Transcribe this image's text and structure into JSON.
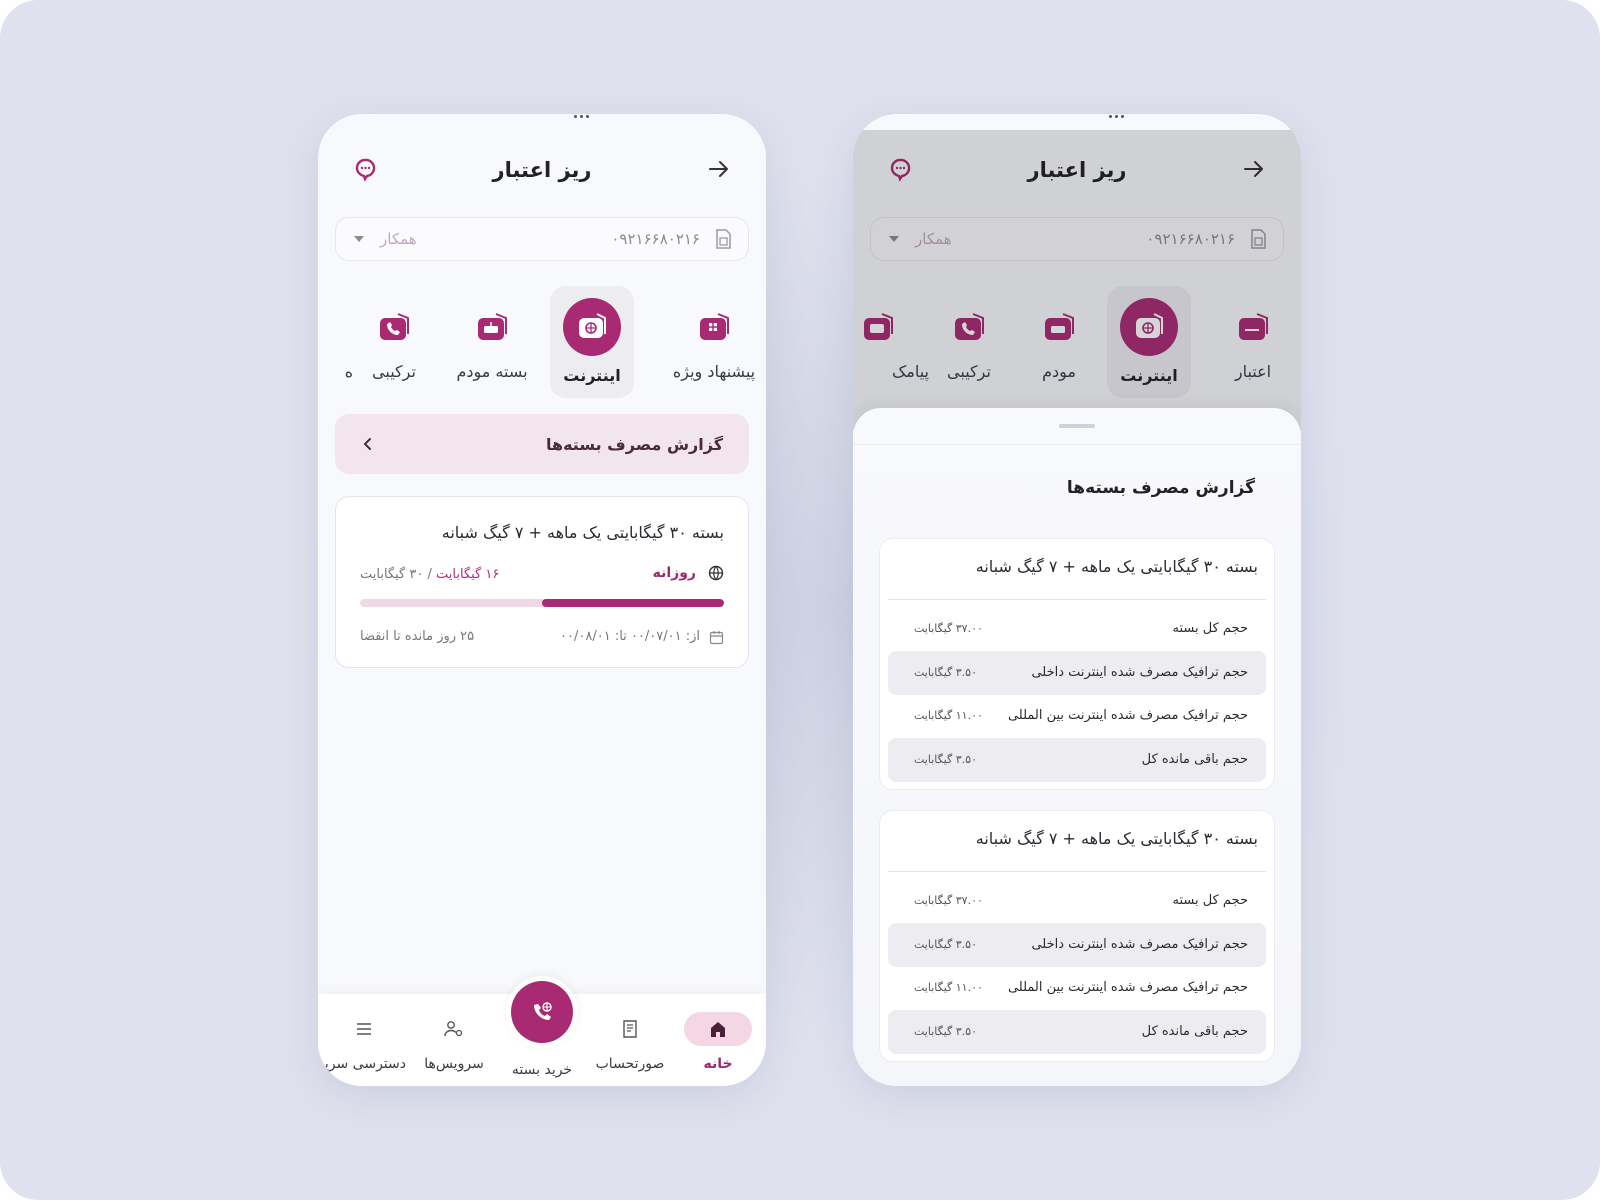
{
  "colors": {
    "accent": "#a82a72",
    "accent_light": "#f1d8e6",
    "background": "#dfe1ee"
  },
  "left_phone": {
    "header": {
      "title": "ریز اعتبار"
    },
    "selector": {
      "number": "۰۹۲۱۶۶۸۰۲۱۶",
      "role": "همکار"
    },
    "categories": [
      {
        "label": "پیشنهاد ویژه",
        "icon": "special-offer-icon",
        "active": false
      },
      {
        "label": "اینترنت",
        "icon": "internet-icon",
        "active": true
      },
      {
        "label": "بسته مودم",
        "icon": "modem-icon",
        "active": false
      },
      {
        "label": "ترکیبی",
        "icon": "combo-icon",
        "active": false
      },
      {
        "label": "ه",
        "icon": "partial-icon",
        "active": false
      }
    ],
    "report_bar": {
      "label": "گزارش مصرف بسته‌ها"
    },
    "package": {
      "name": "بسته ۳۰ گیگابایتی یک ماهه + ۷ گیگ شبانه",
      "period": "روزانه",
      "used": "۱۶ گیگابایت",
      "sep": " / ",
      "total": "۳۰ گیگابایت",
      "progress": 0.5,
      "dates": "از: ۰۰/۰۷/۰۱  تا: ۰۰/۰۸/۰۱",
      "remaining": "۲۵ روز مانده تا انقضا"
    },
    "bottom_nav": [
      {
        "label": "خانه",
        "icon": "home-icon",
        "active": true
      },
      {
        "label": "صورتحساب",
        "icon": "bill-icon",
        "active": false
      },
      {
        "label": "خرید بسته",
        "icon": "buy-package-icon",
        "active": false
      },
      {
        "label": "سرویس‌ها",
        "icon": "services-icon",
        "active": false
      },
      {
        "label": "دسترسی سریع",
        "icon": "menu-icon",
        "active": false
      }
    ]
  },
  "right_phone": {
    "header": {
      "title": "ریز اعتبار"
    },
    "selector": {
      "number": "۰۹۲۱۶۶۸۰۲۱۶",
      "role": "همکار"
    },
    "categories": [
      {
        "label": "اعتبار",
        "icon": "credit-icon",
        "active": false
      },
      {
        "label": "اینترنت",
        "icon": "internet-icon",
        "active": true
      },
      {
        "label": "مودم",
        "icon": "modem-icon",
        "active": false
      },
      {
        "label": "ترکیبی",
        "icon": "combo-icon",
        "active": false
      },
      {
        "label": "پیامک",
        "icon": "sms-icon",
        "active": false
      }
    ],
    "sheet": {
      "title": "گزارش مصرف بسته‌ها",
      "cards": [
        {
          "name": "بسته ۳۰ گیگابایتی یک ماهه + ۷ گیگ شبانه",
          "rows": [
            {
              "label": "حجم کل بسته",
              "value": "۳۷.۰۰ گیگابایت"
            },
            {
              "label": "حجم ترافیک مصرف شده اینترنت داخلی",
              "value": "۳.۵۰ گیگابایت"
            },
            {
              "label": "حجم ترافیک مصرف شده اینترنت بین المللی",
              "value": "۱۱.۰۰ گیگابایت"
            },
            {
              "label": "حجم باقی مانده کل",
              "value": "۳.۵۰ گیگابایت"
            }
          ]
        },
        {
          "name": "بسته ۳۰ گیگابایتی یک ماهه + ۷ گیگ شبانه",
          "rows": [
            {
              "label": "حجم کل بسته",
              "value": "۳۷.۰۰ گیگابایت"
            },
            {
              "label": "حجم ترافیک مصرف شده اینترنت داخلی",
              "value": "۳.۵۰ گیگابایت"
            },
            {
              "label": "حجم ترافیک مصرف شده اینترنت بین المللی",
              "value": "۱۱.۰۰ گیگابایت"
            },
            {
              "label": "حجم باقی مانده کل",
              "value": "۳.۵۰ گیگابایت"
            }
          ]
        }
      ]
    }
  }
}
